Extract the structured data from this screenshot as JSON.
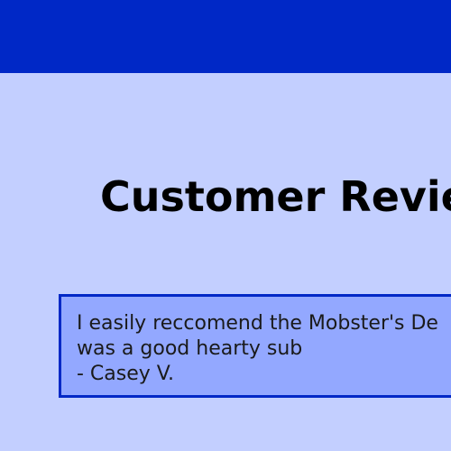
{
  "header": {
    "background_color": "#0028c6"
  },
  "main": {
    "background_color": "#c3cfff",
    "title": "Customer Revie"
  },
  "review": {
    "card_color": "#93a8ff",
    "border_color": "#0028c6",
    "lines": [
      "I easily reccomend the Mobster's De",
      "was a good hearty sub",
      "- Casey V."
    ]
  }
}
